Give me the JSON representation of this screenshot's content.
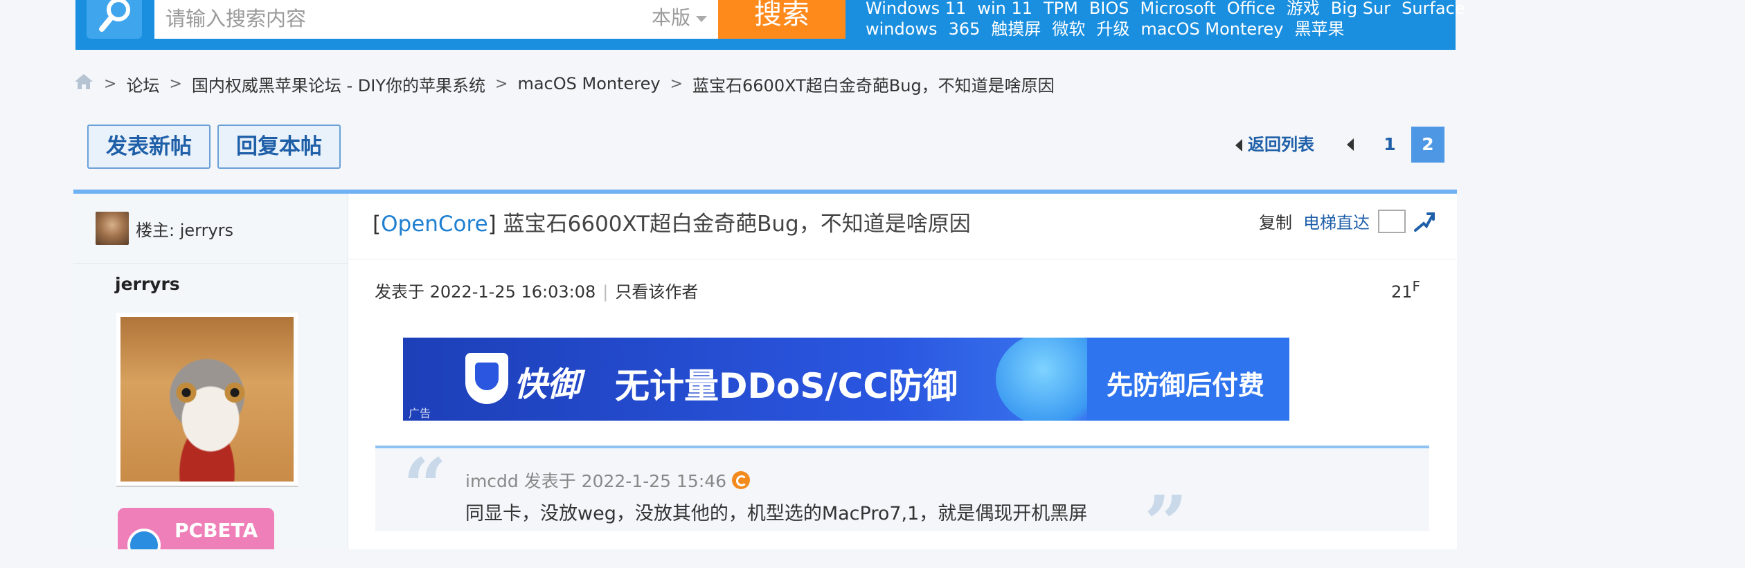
{
  "search": {
    "placeholder": "请输入搜索内容",
    "scope": "本版",
    "button": "搜索"
  },
  "hot_keywords": {
    "row1": [
      "Windows 11",
      "win 11",
      "TPM",
      "BIOS",
      "Microsoft",
      "Office",
      "游戏",
      "Big Sur",
      "Surface"
    ],
    "row2": [
      "windows",
      "365",
      "触摸屏",
      "微软",
      "升级",
      "macOS Monterey",
      "黑苹果"
    ]
  },
  "breadcrumb": {
    "items": [
      "论坛",
      "国内权威黑苹果论坛 - DIY你的苹果系统",
      "macOS Monterey",
      "蓝宝石6600XT超白金奇葩Bug，不知道是啥原因"
    ]
  },
  "actions": {
    "new_post": "发表新帖",
    "reply": "回复本帖"
  },
  "pager": {
    "back": "返回列表",
    "pages": [
      "1",
      "2"
    ],
    "current": "2"
  },
  "post": {
    "op_label": "楼主: jerryrs",
    "username": "jerryrs",
    "medal": "PCBETA",
    "title_prefix": "[",
    "tag": "OpenCore",
    "title_suffix": "]",
    "title": "蓝宝石6600XT超白金奇葩Bug，不知道是啥原因",
    "copy": "复制",
    "jump": "电梯直达",
    "posted_at": "发表于 2022-1-25 16:03:08",
    "only_author": "只看该作者",
    "floor_num": "21",
    "floor_suffix": "F"
  },
  "ad": {
    "brand": "快御",
    "headline": "无计量DDoS/CC防御",
    "slogan": "先防御后付费",
    "tag": "广告"
  },
  "quote": {
    "header": "imcdd 发表于 2022-1-25 15:46",
    "text": "同显卡，没放weg，没放其他的，机型选的MacPro7,1，就是偶现开机黑屏"
  },
  "colors": {
    "topbar": "#1a8fe0",
    "search_button": "#ff8a1c",
    "link": "#1e5fa8",
    "tag": "#1e7fd1",
    "page_current": "#4e97e4"
  }
}
